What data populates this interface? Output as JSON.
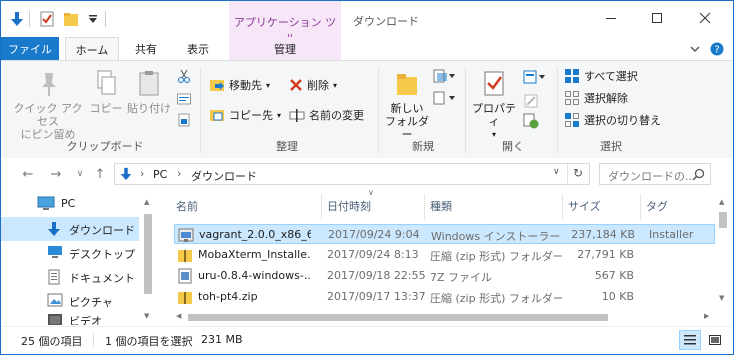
{
  "title_bar": {
    "context_group": "アプリケーション ツール",
    "window_title": "ダウンロード"
  },
  "tabs": {
    "file": "ファイル",
    "home": "ホーム",
    "share": "共有",
    "view": "表示",
    "manage": "管理"
  },
  "ribbon": {
    "clipboard": {
      "pin_quick_access": "クイック アクセス\nにピン留め",
      "copy": "コピー",
      "paste": "貼り付け",
      "group": "クリップボード"
    },
    "organize": {
      "move_to": "移動先",
      "copy_to": "コピー先",
      "delete": "削除",
      "rename": "名前の変更",
      "group": "整理"
    },
    "new": {
      "new_folder": "新しい\nフォルダー",
      "group": "新規"
    },
    "open": {
      "properties": "プロパティ",
      "group": "開く"
    },
    "select": {
      "select_all": "すべて選択",
      "select_none": "選択解除",
      "invert": "選択の切り替え",
      "group": "選択"
    }
  },
  "address": {
    "crumbs": [
      "PC",
      "ダウンロード"
    ],
    "search_placeholder": "ダウンロードの..."
  },
  "nav_pane": {
    "items": [
      {
        "label": "PC",
        "icon": "pc-icon"
      },
      {
        "label": "ダウンロード",
        "icon": "download-folder-icon",
        "selected": true
      },
      {
        "label": "デスクトップ",
        "icon": "desktop-icon"
      },
      {
        "label": "ドキュメント",
        "icon": "documents-icon"
      },
      {
        "label": "ピクチャ",
        "icon": "pictures-icon"
      },
      {
        "label": "ビデオ",
        "icon": "videos-icon"
      }
    ]
  },
  "columns": {
    "name": "名前",
    "date": "日付時刻",
    "type": "種類",
    "size": "サイズ",
    "tag": "タグ"
  },
  "files": [
    {
      "name": "vagrant_2.0.0_x86_6...",
      "date": "2017/09/24 9:04",
      "type": "Windows インストーラー ...",
      "size": "237,184 KB",
      "tag": "Installer",
      "icon": "msi-installer-icon",
      "selected": true
    },
    {
      "name": "MobaXterm_Installe...",
      "date": "2017/09/24 8:13",
      "type": "圧縮 (zip 形式) フォルダー",
      "size": "27,791 KB",
      "tag": "",
      "icon": "zip-folder-icon"
    },
    {
      "name": "uru-0.8.4-windows-...",
      "date": "2017/09/18 22:55",
      "type": "7Z ファイル",
      "size": "567 KB",
      "tag": "",
      "icon": "7z-file-icon"
    },
    {
      "name": "toh-pt4.zip",
      "date": "2017/09/17 13:37",
      "type": "圧縮 (zip 形式) フォルダー",
      "size": "10 KB",
      "tag": "",
      "icon": "zip-folder-icon"
    }
  ],
  "status": {
    "item_count": "25 個の項目",
    "selection": "1 個の項目を選択",
    "selection_size": "231 MB"
  }
}
